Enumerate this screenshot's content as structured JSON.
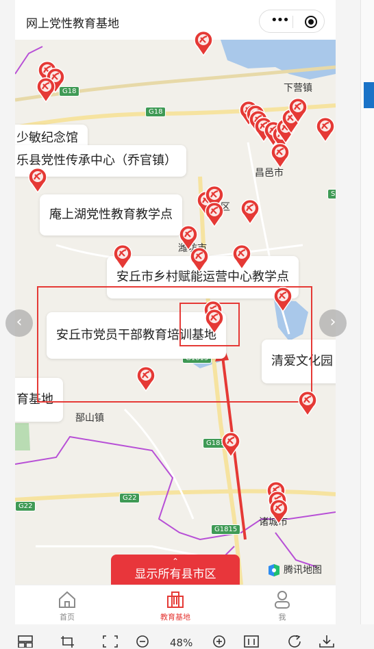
{
  "header": {
    "title": "网上党性教育基地"
  },
  "map": {
    "places": {
      "xiaying": "下营镇",
      "changyi": "昌邑市",
      "weifang": "潍坊市",
      "qu": "区",
      "haoshan": "郚山镇",
      "zhucheng": "诸城市"
    },
    "highways": {
      "g18_a": "G18",
      "g18_b": "G18",
      "g1815_a": "G1815",
      "g181": "G181",
      "g22_a": "G22",
      "g22_b": "G22",
      "g1815_b": "G1815",
      "s_partial": "S"
    },
    "callouts": {
      "shaomin": "少敏纪念馆",
      "lexian": "乐县党性传承中心（乔官镇）",
      "anshanghu": "庵上湖党性教育教学点",
      "anqiu_rural": "安丘市乡村赋能运营中心教学点",
      "anqiu_cadre": "安丘市党员干部教育培训基地",
      "qingai": "清爱文化园",
      "yu_base": "育基地"
    },
    "show_all_button": "显示所有县市区",
    "provider": "腾讯地图"
  },
  "tabs": [
    {
      "label": "首页",
      "icon": "home-icon",
      "active": false
    },
    {
      "label": "教育基地",
      "icon": "building-icon",
      "active": true
    },
    {
      "label": "我",
      "icon": "user-icon",
      "active": false
    }
  ],
  "viewer": {
    "zoom": "48%"
  },
  "colors": {
    "accent": "#e8363b",
    "annotation": "#e53935",
    "map_bg": "#f2f0ea",
    "highway": "#3f9a55"
  }
}
